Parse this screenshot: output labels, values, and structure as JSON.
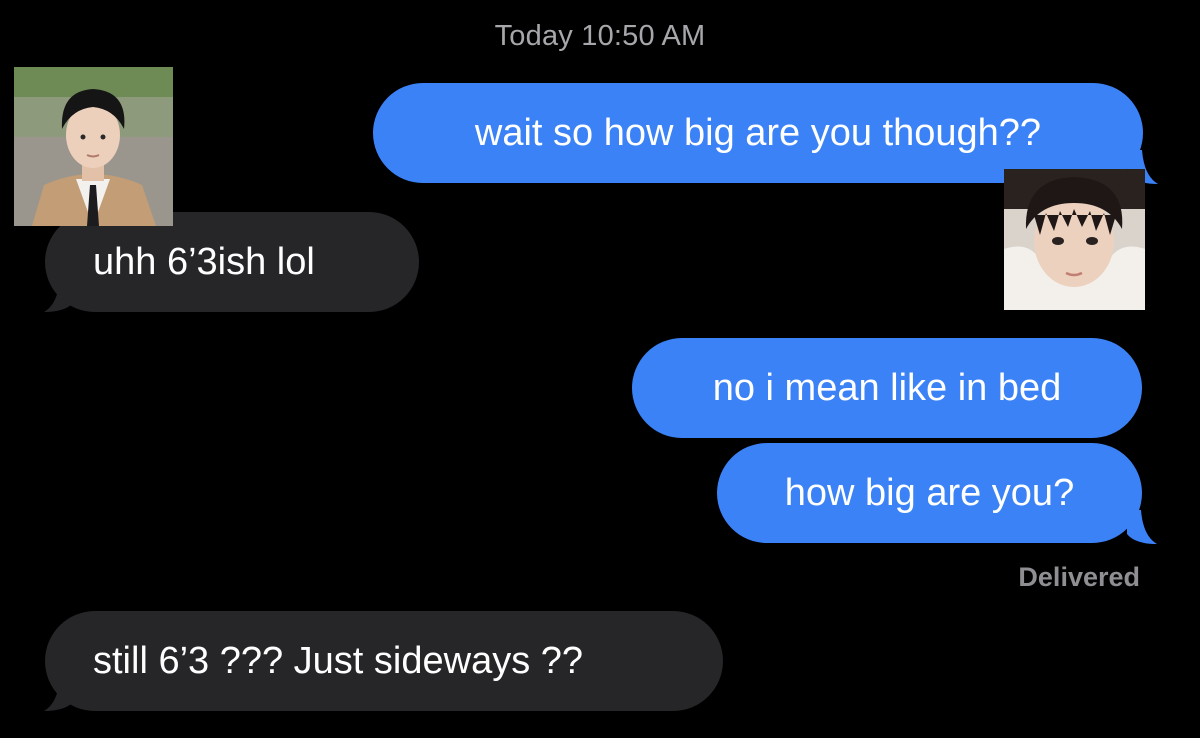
{
  "conversation": {
    "timestamp": "Today 10:50 AM",
    "messages": [
      {
        "direction": "sent",
        "text": "wait so how big are you though??"
      },
      {
        "direction": "received",
        "text": "uhh 6’3ish lol"
      },
      {
        "direction": "sent",
        "text": "no i mean like in bed"
      },
      {
        "direction": "sent",
        "text": "how big are you?"
      },
      {
        "direction": "received",
        "text": "still 6’3 ??? Just sideways ??"
      }
    ],
    "delivery_status": "Delivered"
  },
  "colors": {
    "background": "#000000",
    "sent_bubble": "#3b82f7",
    "received_bubble": "#262629",
    "meta_text": "#8e8e93"
  }
}
